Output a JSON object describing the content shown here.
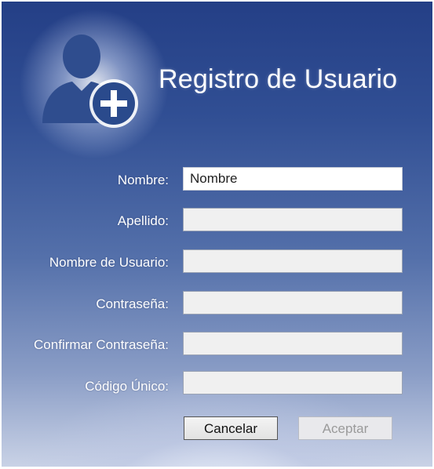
{
  "window": {
    "title": "Registro de Usuario"
  },
  "header": {
    "icon": "add-user-icon",
    "colors": {
      "silhouette": "#2f4d8e",
      "badge": "#2a4a8c",
      "plus": "#ffffff"
    }
  },
  "form": {
    "fields": [
      {
        "label": "Nombre:",
        "value": "Nombre",
        "active": true
      },
      {
        "label": "Apellido:",
        "value": ""
      },
      {
        "label": "Nombre de Usuario:",
        "value": ""
      },
      {
        "label": "Contraseña:",
        "value": ""
      },
      {
        "label": "Confirmar Contraseña:",
        "value": ""
      },
      {
        "label": "Código Único:",
        "value": ""
      }
    ]
  },
  "buttons": {
    "cancel": "Cancelar",
    "accept": "Aceptar",
    "accept_enabled": false
  },
  "colors": {
    "background_top": "#243f86",
    "background_bottom": "#c9d2e6",
    "label_text": "#ffffff",
    "input_bg": "#f0f0f0",
    "disabled_text": "#9a9a9a"
  }
}
